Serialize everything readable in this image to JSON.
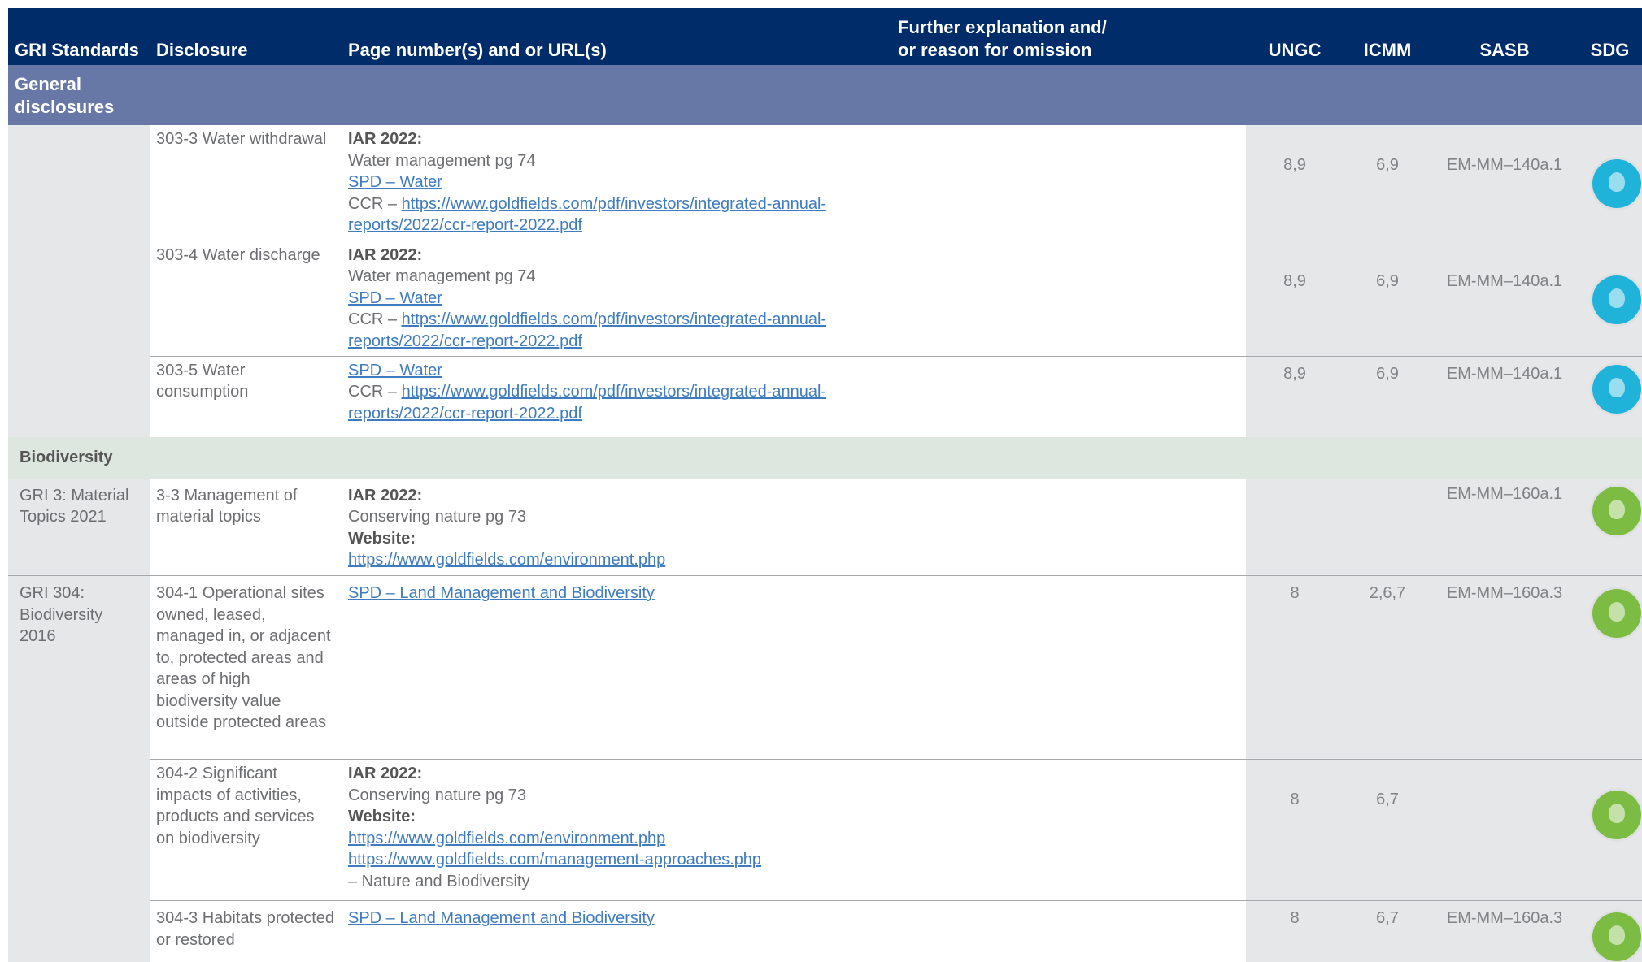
{
  "header": {
    "gri": "GRI Standards",
    "disclosure": "Disclosure",
    "page": "Page number(s) and or URL(s)",
    "expl_1": "Further explanation and/",
    "expl_2": "or reason for omission",
    "ungc": "UNGC",
    "icmm": "ICMM",
    "sasb": "SASB",
    "sdg": "SDG"
  },
  "section": {
    "line1": "General",
    "line2": "disclosures"
  },
  "water_rows": [
    {
      "disclosure": "303-3 Water withdrawal",
      "iar": "IAR 2022:",
      "text": "Water management pg 74",
      "spd": "SPD – Water",
      "ccr_prefix": "CCR – ",
      "ccr_link_1": "https://www.goldfields.com/pdf/investors/integrated-annual-",
      "ccr_link_2": "reports/2022/ccr-report-2022.pdf",
      "ungc": "8,9",
      "icmm": "6,9",
      "sasb": "EM-MM–140a.1",
      "sdg_icon": "sdg-6-clean-water-icon"
    },
    {
      "disclosure": "303-4 Water discharge",
      "iar": "IAR 2022:",
      "text": "Water management pg 74",
      "spd": "SPD – Water",
      "ccr_prefix": "CCR – ",
      "ccr_link_1": "https://www.goldfields.com/pdf/investors/integrated-annual-",
      "ccr_link_2": "reports/2022/ccr-report-2022.pdf",
      "ungc": "8,9",
      "icmm": "6,9",
      "sasb": "EM-MM–140a.1",
      "sdg_icon": "sdg-6-clean-water-icon"
    },
    {
      "disclosure": "303-5 Water consumption",
      "spd": "SPD – Water",
      "ccr_prefix": "CCR – ",
      "ccr_link_1": "https://www.goldfields.com/pdf/investors/integrated-annual-",
      "ccr_link_2": "reports/2022/ccr-report-2022.pdf",
      "ungc": "8,9",
      "icmm": "6,9",
      "sasb": "EM-MM–140a.1",
      "sdg_icon": "sdg-6-clean-water-icon"
    }
  ],
  "biodiversity": {
    "title": "Biodiversity",
    "gri3": "GRI 3: Material Topics 2021",
    "row_33": {
      "disclosure": "3-3 Management of material topics",
      "iar": "IAR 2022:",
      "text": "Conserving nature pg 73",
      "website": "Website:",
      "link": "https://www.goldfields.com/environment.php",
      "ungc": "",
      "icmm": "",
      "sasb": "EM-MM–160a.1",
      "sdg_icon": "sdg-15-life-on-land-icon"
    },
    "gri304": "GRI 304: Biodiversity 2016",
    "row_3041": {
      "disclosure": "304-1 Operational sites owned, leased, managed in, or adjacent to, protected areas and areas of high biodiversity value outside protected areas",
      "spd": "SPD – Land Management and Biodiversity",
      "ungc": "8",
      "icmm": "2,6,7",
      "sasb": "EM-MM–160a.3",
      "sdg_icon": "sdg-15-life-on-land-icon"
    },
    "row_3042": {
      "disclosure": "304-2 Significant impacts of activities, products and services on biodiversity",
      "iar": "IAR 2022:",
      "text": "Conserving nature pg 73",
      "website": "Website:",
      "link_1": "https://www.goldfields.com/environment.php",
      "link_2": "https://www.goldfields.com/management-approaches.php",
      "tail": "– Nature and Biodiversity",
      "ungc": "8",
      "icmm": "6,7",
      "sasb": "",
      "sdg_icon": "sdg-15-life-on-land-icon"
    },
    "row_3043": {
      "disclosure": "304-3 Habitats protected or restored",
      "spd": "SPD – Land Management and Biodiversity",
      "ungc": "8",
      "icmm": "6,7",
      "sasb": "EM-MM–160a.3",
      "sdg_icon": "sdg-15-life-on-land-icon"
    }
  },
  "colors": {
    "header_bg": "#002c6a",
    "section_bg": "#6878a6",
    "subsection_bg": "#dde7e0",
    "link": "#3f7cbf",
    "sdg6": "#1fb3d9",
    "sdg15": "#7cbc42"
  }
}
